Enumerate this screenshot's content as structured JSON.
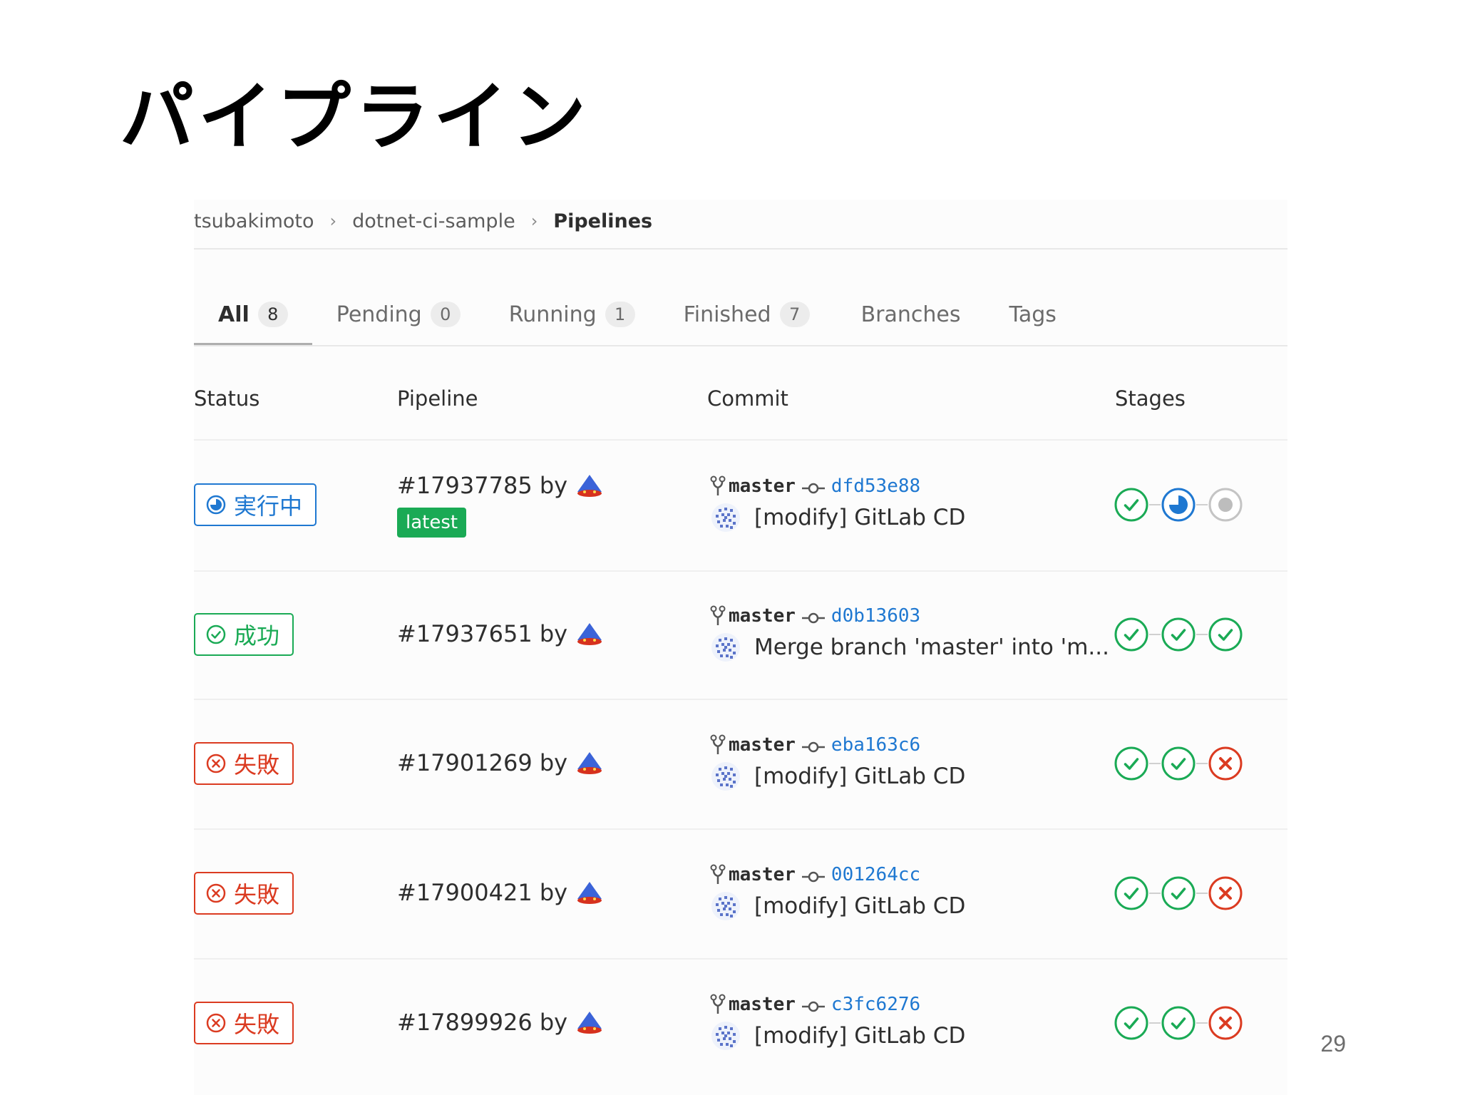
{
  "slide": {
    "title": "パイプライン",
    "page_number": "29"
  },
  "breadcrumb": {
    "items": [
      "tsubakimoto",
      "dotnet-ci-sample"
    ],
    "current": "Pipelines"
  },
  "tabs": [
    {
      "label": "All",
      "count": "8",
      "active": true
    },
    {
      "label": "Pending",
      "count": "0"
    },
    {
      "label": "Running",
      "count": "1"
    },
    {
      "label": "Finished",
      "count": "7"
    },
    {
      "label": "Branches"
    },
    {
      "label": "Tags"
    }
  ],
  "table": {
    "headers": {
      "status": "Status",
      "pipeline": "Pipeline",
      "commit": "Commit",
      "stages": "Stages"
    },
    "rows": [
      {
        "status": "実行中",
        "status_type": "running",
        "pipeline": "#17937785 by",
        "badge": "latest",
        "branch": "master",
        "sha": "dfd53e88",
        "message": "[modify] GitLab CD",
        "stages": [
          "success",
          "running",
          "created"
        ]
      },
      {
        "status": "成功",
        "status_type": "success",
        "pipeline": "#17937651 by",
        "branch": "master",
        "sha": "d0b13603",
        "message": "Merge branch 'master' into 'm...",
        "stages": [
          "success",
          "success",
          "success"
        ]
      },
      {
        "status": "失敗",
        "status_type": "failed",
        "pipeline": "#17901269 by",
        "branch": "master",
        "sha": "eba163c6",
        "message": "[modify] GitLab CD",
        "stages": [
          "success",
          "success",
          "failed"
        ]
      },
      {
        "status": "失敗",
        "status_type": "failed",
        "pipeline": "#17900421 by",
        "branch": "master",
        "sha": "001264cc",
        "message": "[modify] GitLab CD",
        "stages": [
          "success",
          "success",
          "failed"
        ]
      },
      {
        "status": "失敗",
        "status_type": "failed",
        "pipeline": "#17899926 by",
        "branch": "master",
        "sha": "c3fc6276",
        "message": "[modify] GitLab CD",
        "stages": [
          "success",
          "success",
          "failed"
        ]
      }
    ]
  },
  "colors": {
    "running": "#1f78d1",
    "success": "#1aaa55",
    "failed": "#db3b21",
    "created": "#c4c4c4",
    "link": "#1f78d1"
  }
}
